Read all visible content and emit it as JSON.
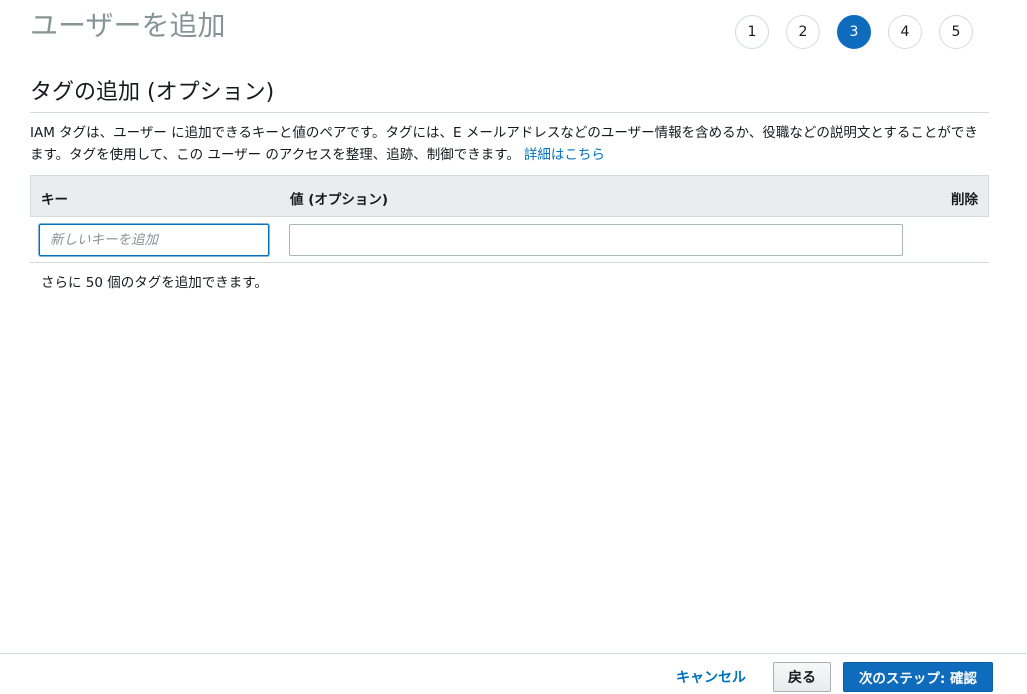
{
  "page": {
    "title": "ユーザーを追加"
  },
  "steps": [
    {
      "label": "1",
      "active": false
    },
    {
      "label": "2",
      "active": false
    },
    {
      "label": "3",
      "active": true
    },
    {
      "label": "4",
      "active": false
    },
    {
      "label": "5",
      "active": false
    }
  ],
  "section": {
    "title": "タグの追加 (オプション)",
    "description": "IAM タグは、ユーザー に追加できるキーと値のペアです。タグには、E メールアドレスなどのユーザー情報を含めるか、役職などの説明文とすることができます。タグを使用して、この ユーザー のアクセスを整理、追跡、制御できます。",
    "learn_more": "詳細はこちら"
  },
  "table": {
    "headers": {
      "key": "キー",
      "value": "値 (オプション)",
      "delete": "削除"
    },
    "rows": [
      {
        "key": "",
        "key_placeholder": "新しいキーを追加",
        "value": ""
      }
    ]
  },
  "remaining_text": "さらに 50 個のタグを追加できます。",
  "footer": {
    "cancel": "キャンセル",
    "back": "戻る",
    "next": "次のステップ: 確認"
  },
  "colors": {
    "accent": "#0f6cbd",
    "link": "#0073bb",
    "title_gray": "#879596"
  }
}
